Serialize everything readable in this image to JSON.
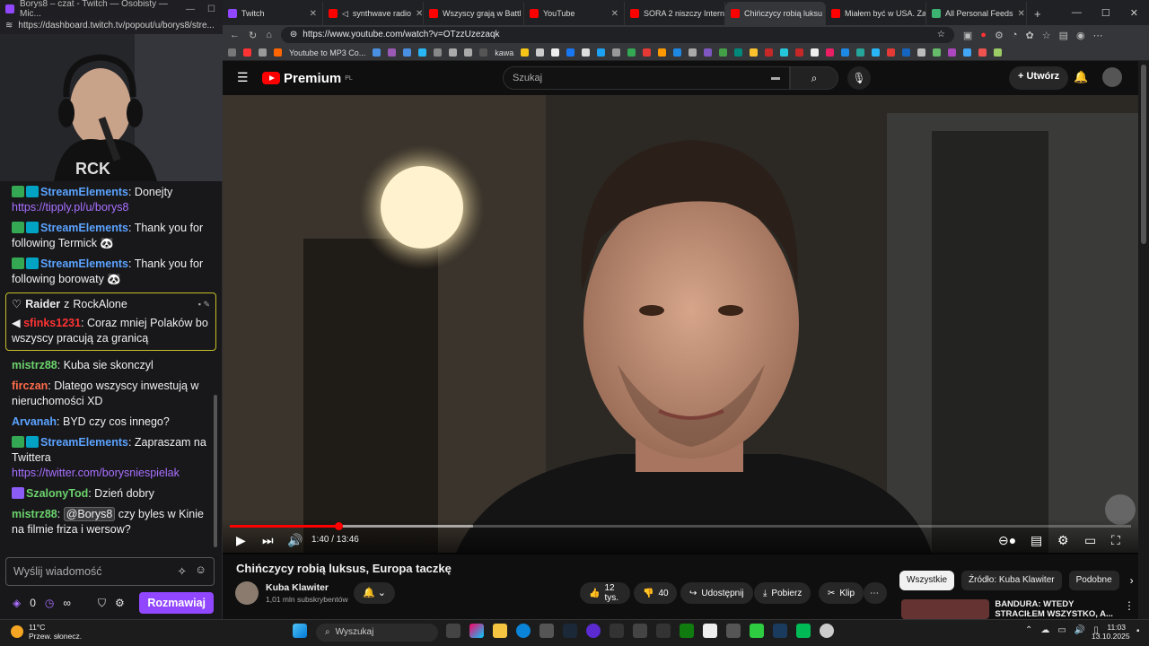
{
  "twitch": {
    "window_title": "Borys8 – czat - Twitch — Osobisty — Mic...",
    "url": "https://dashboard.twitch.tv/popout/u/borys8/stre...",
    "chat": [
      {
        "user": "StreamElements",
        "color": "#5ba3ff",
        "badges": [
          "green",
          "teal"
        ],
        "text": "Donejty",
        "link": "https://tipply.pl/u/borys8"
      },
      {
        "user": "StreamElements",
        "color": "#5ba3ff",
        "badges": [
          "green",
          "teal"
        ],
        "text": "Thank you for following Termick 🐼"
      },
      {
        "user": "StreamElements",
        "color": "#5ba3ff",
        "badges": [
          "green",
          "teal"
        ],
        "text": "Thank you for following borowaty 🐼"
      },
      {
        "user": "mistrz88",
        "color": "#6cd36c",
        "text": "Kuba sie skonczyl"
      },
      {
        "user": "firczan",
        "color": "#ff6b4a",
        "text": "Dlatego wszyscy inwestują w nieruchomości XD"
      },
      {
        "user": "Arvanah",
        "color": "#5ba3ff",
        "text": "BYD czy cos innego?"
      },
      {
        "user": "StreamElements",
        "color": "#5ba3ff",
        "badges": [
          "green",
          "teal"
        ],
        "text": "Zapraszam na Twittera",
        "link": "https://twitter.com/borysniespielak"
      },
      {
        "user": "SzalonyTod",
        "color": "#6cd36c",
        "badges": [
          "purple"
        ],
        "text": "Dzień dobry"
      }
    ],
    "raid": {
      "label": "Raider",
      "from_word": "z",
      "from": "RockAlone",
      "user": "sfinks1231",
      "user_color": "#ff3333",
      "text": "Coraz mniej Polaków bo wszyscy pracują za granicą"
    },
    "last_msg": {
      "user": "mistrz88",
      "color": "#6cd36c",
      "mention": "@Borys8",
      "text": "czy byles w Kinie na filmie friza i wersow?"
    },
    "input_placeholder": "Wyślij wiadomość",
    "points": "0",
    "chat_button": "Rozmawiaj"
  },
  "browser": {
    "tabs": [
      {
        "label": "Twitch",
        "color": "#9147ff",
        "active": false
      },
      {
        "label": "synthwave radio",
        "color": "#ff0000",
        "active": false
      },
      {
        "label": "Wszyscy grają w Battl",
        "color": "#ff0000",
        "active": false
      },
      {
        "label": "YouTube",
        "color": "#ff0000",
        "active": false
      },
      {
        "label": "SORA 2 niszczy Intern",
        "color": "#ff0000",
        "active": false
      },
      {
        "label": "Chińczycy robią luksu",
        "color": "#ff0000",
        "active": true
      },
      {
        "label": "Miałem być w USA. Za",
        "color": "#ff0000",
        "active": false
      },
      {
        "label": "All Personal Feeds",
        "color": "#3cb371",
        "active": false
      }
    ],
    "url": "https://www.youtube.com/watch?v=OTzzUzezaqk",
    "bookmarks": [
      "Youtube to MP3 Co...",
      "kawa"
    ]
  },
  "youtube": {
    "logo": "Premium",
    "logo_sup": "PL",
    "search_placeholder": "Szukaj",
    "create_label": "Utwórz",
    "time": "1:40 / 13:46",
    "progress": {
      "watched_fraction": 0.121,
      "buffered_fraction": 0.27
    },
    "title": "Chińczycy robią luksus, Europa taczkę",
    "channel": "Kuba Klawiter",
    "subs": "1,01 mln subskrybentów",
    "likes": "12 tys.",
    "dislikes": "40",
    "share": "Udostępnij",
    "download": "Pobierz",
    "clip": "Klip",
    "chips": [
      "Wszystkie",
      "Źródło: Kuba Klawiter",
      "Podobne"
    ],
    "next_title": "BANDURA: WTEDY STRACIŁEM WSZYSTKO, A..."
  },
  "taskbar": {
    "temp": "11°C",
    "weather": "Przew. słonecz.",
    "search": "Wyszukaj",
    "time": "11:03",
    "date": "13.10.2025"
  }
}
